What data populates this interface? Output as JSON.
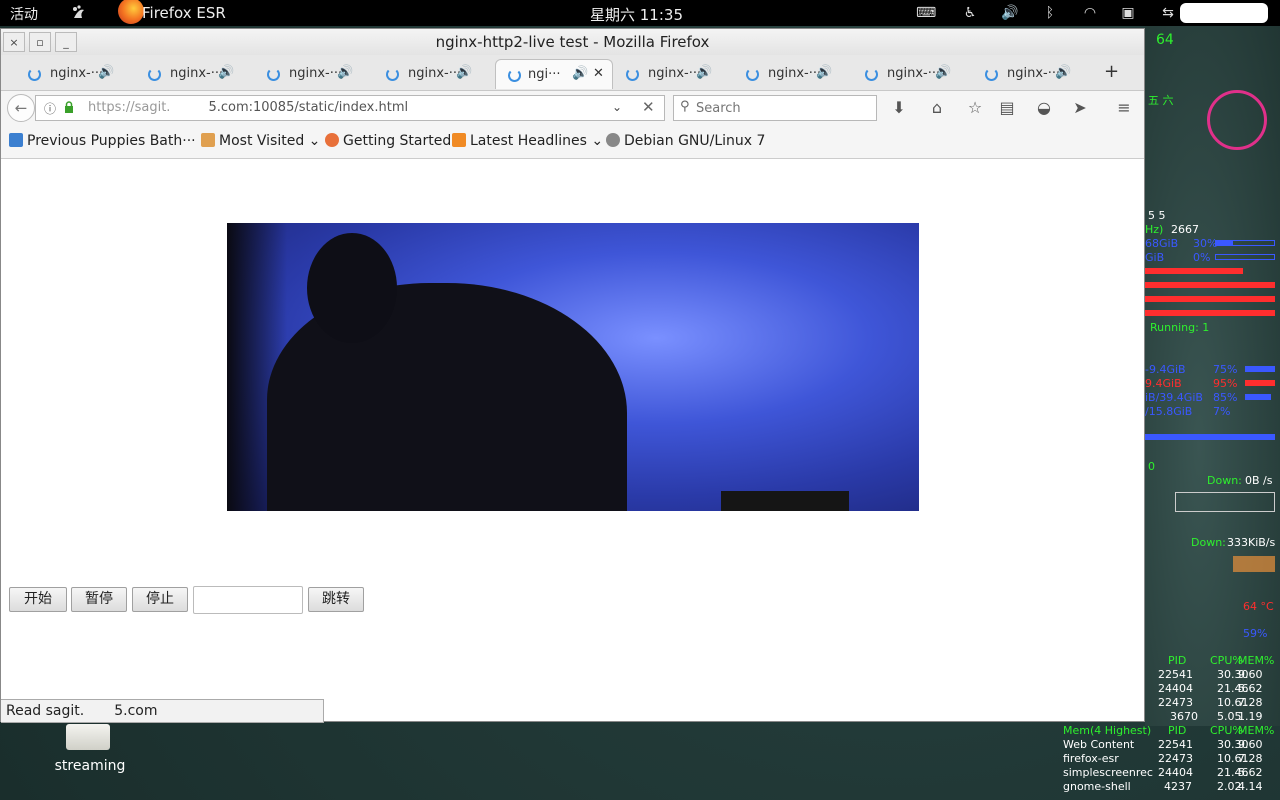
{
  "topbar": {
    "activities": "活动",
    "app_name": "Firefox ESR",
    "clock": "星期六 11:35",
    "tray_icons": [
      "keyboard-icon",
      "accessibility-icon",
      "volume-icon",
      "bluetooth-icon",
      "wifi-icon",
      "clipboard-icon",
      "network-icon"
    ]
  },
  "window": {
    "title": "nginx-http2-live test - Mozilla Firefox",
    "close_glyph": "×",
    "maximize_glyph": "▫",
    "minimize_glyph": "_"
  },
  "tabs": [
    {
      "label": "nginx-···",
      "active": false
    },
    {
      "label": "nginx-···",
      "active": false
    },
    {
      "label": "nginx-···",
      "active": false
    },
    {
      "label": "nginx-···",
      "active": false
    },
    {
      "label": "ngi···",
      "active": true
    },
    {
      "label": "nginx-···",
      "active": false
    },
    {
      "label": "nginx-···",
      "active": false
    },
    {
      "label": "nginx-···",
      "active": false
    },
    {
      "label": "nginx-···",
      "active": false
    }
  ],
  "navbar": {
    "url_prefix": "https://sagit.",
    "url_suffix": "5.com",
    "url_path": ":10085/static/index.html",
    "search_placeholder": "Search"
  },
  "bookmarks": {
    "item1": "Previous Puppies Bath···",
    "item2": "Most Visited",
    "item3": "Getting Started",
    "item4": "Latest Headlines",
    "item5": "Debian GNU/Linux 7"
  },
  "controls": {
    "start": "开始",
    "pause": "暂停",
    "stop": "停止",
    "seek_value": "",
    "jump": "跳转"
  },
  "status": {
    "prefix": "Read sagit.",
    "suffix": "5.com"
  },
  "desktop": {
    "icon_label": "streaming"
  },
  "conky": {
    "top_num": "64",
    "label_wu": "五 六",
    "line_a": "5 5",
    "freq": "2667",
    "hz_label": "Hz)",
    "mem1_total": "68GiB",
    "mem1_pct": "30%",
    "mem2_total": "GiB",
    "mem2_pct": "0%",
    "running": "Running: 1",
    "disk1": "-9.4GiB",
    "disk1_pct": "75%",
    "disk2": "9.4GiB",
    "disk2_pct": "95%",
    "disk3": "iB/39.4GiB",
    "disk3_pct": "85%",
    "disk4": "/15.8GiB",
    "disk4_pct": "7%",
    "zero": "0",
    "down1_label": "Down:",
    "down1_val": "0B  /s",
    "down2_label": "Down:",
    "down2_val": "333KiB/s",
    "temp": "64 °C",
    "pct59": "59%",
    "cpu_header": [
      "PID",
      "CPU%",
      "MEM%"
    ],
    "cpu_rows": [
      [
        "22541",
        "30.30",
        "9.60"
      ],
      [
        "24404",
        "21.46",
        "5.62"
      ],
      [
        "22473",
        "10.61",
        "7.28"
      ],
      [
        "3670",
        "5.05",
        "1.19"
      ]
    ],
    "mem_header": [
      "Mem(4 Highest)",
      "PID",
      "CPU%",
      "MEM%"
    ],
    "mem_rows": [
      [
        "Web Content",
        "22541",
        "30.30",
        "9.60"
      ],
      [
        "firefox-esr",
        "22473",
        "10.61",
        "7.28"
      ],
      [
        "simplescreenrec",
        "24404",
        "21.46",
        "5.62"
      ],
      [
        "gnome-shell",
        "4237",
        "2.02",
        "4.14"
      ]
    ]
  },
  "colors": {
    "conky_green": "#2ef02e",
    "conky_blue": "#3a58ff",
    "conky_red": "#ff2e2e",
    "firefox_spinner": "#3b8fe0"
  }
}
